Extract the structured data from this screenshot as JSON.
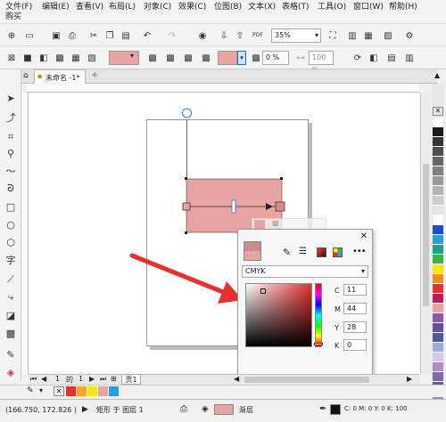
{
  "menu": {
    "row1": [
      "文件(F)",
      "编辑(E)",
      "查看(V)",
      "布局(L)",
      "对象(C)",
      "效果(C)",
      "位图(B)",
      "文本(X)",
      "表格(T)",
      "工具(O)",
      "窗口(W)",
      "帮助(H)"
    ],
    "row2": [
      "购买"
    ]
  },
  "toolbar": {
    "zoom_value": "35%",
    "pdf_label": "PDF"
  },
  "propbar": {
    "outline_pct": "0 %",
    "transparency_value": "100 %"
  },
  "document": {
    "tab_title": "未命名 -1*",
    "add_tab": "+"
  },
  "pages": {
    "current": "1",
    "of_label": "的",
    "total": "1",
    "page_tab": "页1"
  },
  "status": {
    "coords": "(166.750, 172.826 )",
    "object_info": "矩形 于 图层 1",
    "fill_name": "渐层",
    "cmyk_readout": "C: 0 M: 0 Y: 0 K: 100"
  },
  "color_popup": {
    "model": "CMYK",
    "c_label": "C",
    "c_value": "11",
    "m_label": "M",
    "m_value": "44",
    "y_label": "Y",
    "y_value": "28",
    "k_label": "K",
    "k_value": "0",
    "close": "✕"
  },
  "colors": {
    "fill": "#e8a3a3",
    "fill_dark": "#d98b8b",
    "arrow": "#e8302f",
    "accent": "#1a73c9"
  },
  "palette_colors": [
    "#ffffff",
    "#1a1a1a",
    "#333333",
    "#4d4d4d",
    "#666666",
    "#808080",
    "#999999",
    "#b3b3b3",
    "#cccccc",
    "#e6e6e6",
    "#ffffff",
    "#1f4bd1",
    "#2a9de0",
    "#1aa38a",
    "#3cb043",
    "#f5e61a",
    "#f28c1a",
    "#e8302f",
    "#c2185b",
    "#e8a3a3",
    "#8e5aa8",
    "#6a4ca0",
    "#4a5aa8",
    "#9ab0d8",
    "#d8c8e8",
    "#b08ac0",
    "#7a6aa8",
    "#5a5ab0",
    "#9090c0",
    "#a0a0a0"
  ],
  "swatchbar_colors": [
    "#e8302f",
    "#f5a623",
    "#f5e61a",
    "#e8a3a3",
    "#2a9de0"
  ]
}
